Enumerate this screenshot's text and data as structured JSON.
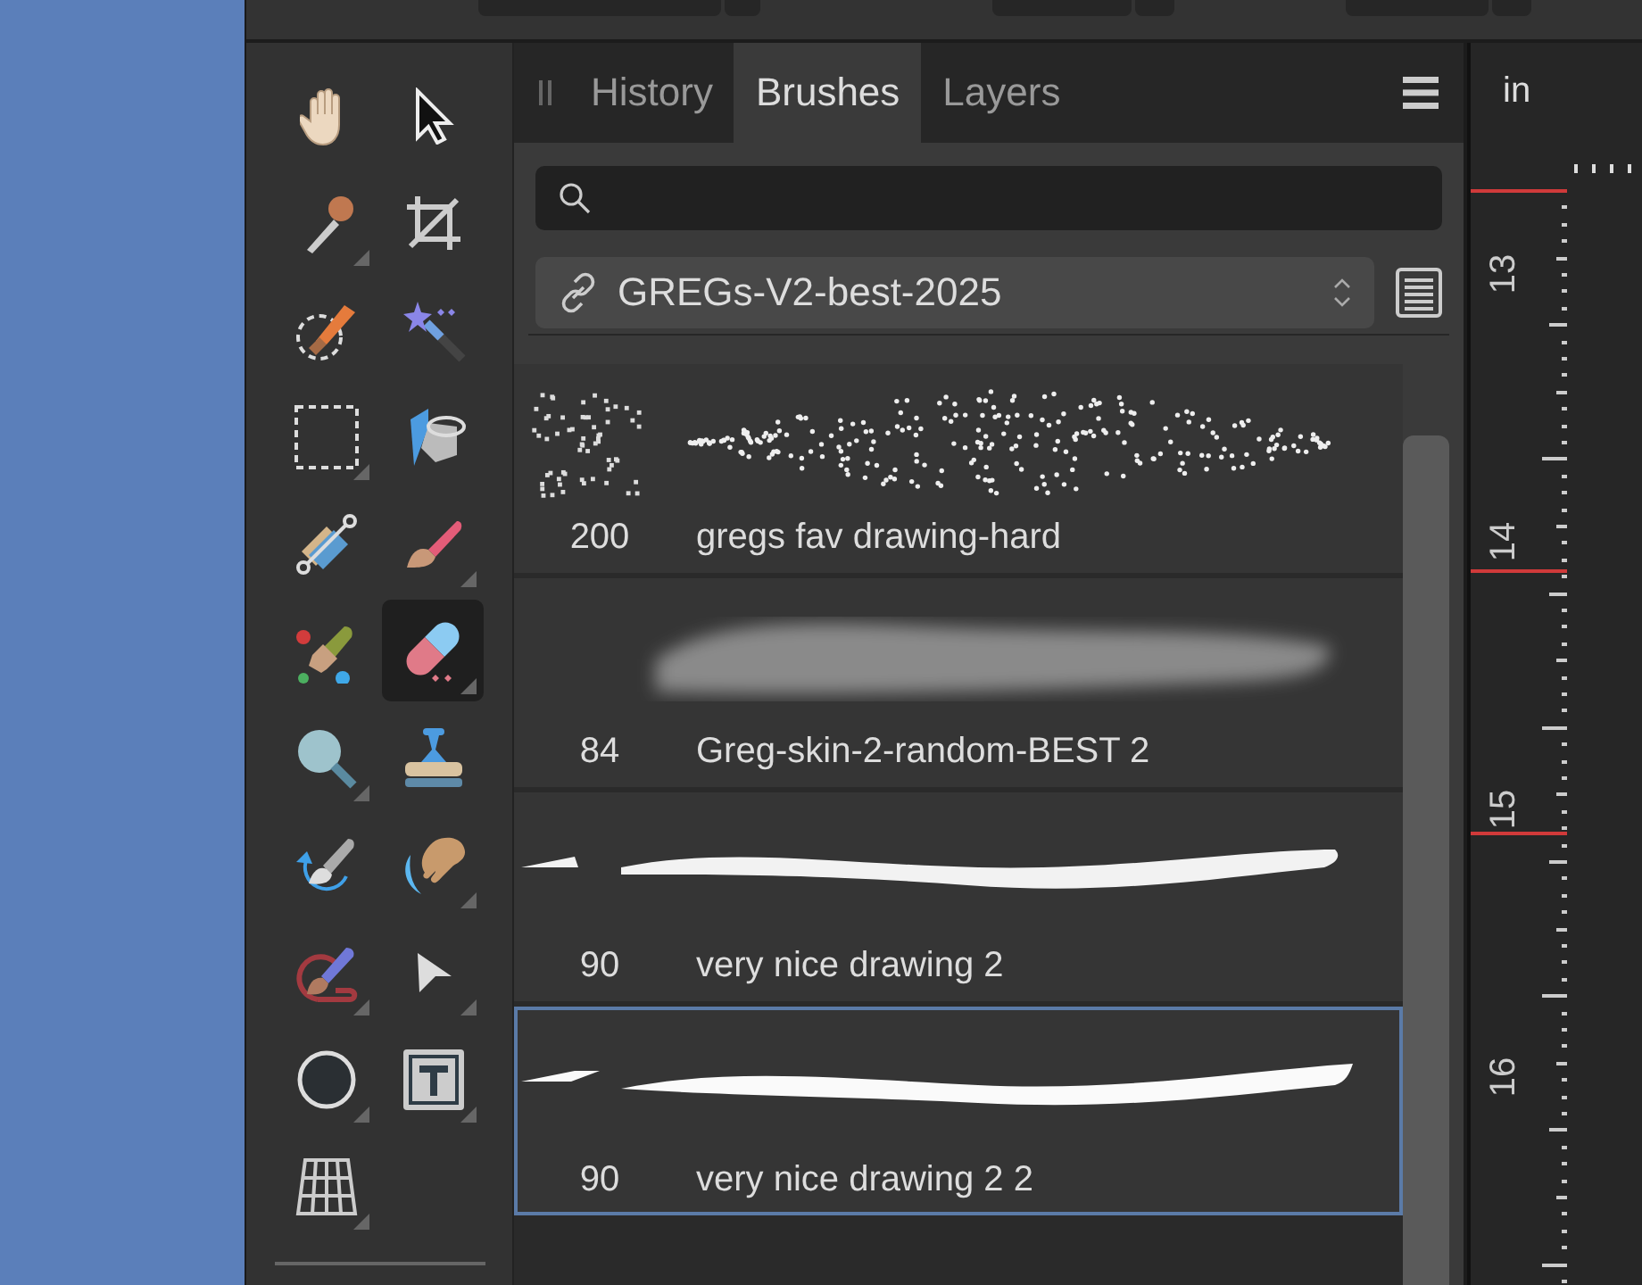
{
  "tools": [
    {
      "selected": false,
      "flyout": false
    },
    {
      "selected": false,
      "flyout": false
    },
    {
      "selected": false,
      "flyout": true
    },
    {
      "selected": false,
      "flyout": false
    },
    {
      "selected": false,
      "flyout": false
    },
    {
      "selected": false,
      "flyout": false
    },
    {
      "selected": false,
      "flyout": true
    },
    {
      "selected": false,
      "flyout": false
    },
    {
      "selected": false,
      "flyout": false
    },
    {
      "selected": false,
      "flyout": true
    },
    {
      "selected": false,
      "flyout": false
    },
    {
      "selected": true,
      "flyout": true
    },
    {
      "selected": false,
      "flyout": true
    },
    {
      "selected": false,
      "flyout": false
    },
    {
      "selected": false,
      "flyout": false
    },
    {
      "selected": false,
      "flyout": true
    },
    {
      "selected": false,
      "flyout": true
    },
    {
      "selected": false,
      "flyout": true
    },
    {
      "selected": false,
      "flyout": true
    },
    {
      "selected": false,
      "flyout": true
    },
    {
      "selected": false,
      "flyout": true
    }
  ],
  "panel": {
    "tabs": [
      {
        "label": "History",
        "selected": false
      },
      {
        "label": "Brushes",
        "selected": true
      },
      {
        "label": "Layers",
        "selected": false
      }
    ],
    "category": "GREGs-V2-best-2025",
    "brushes": [
      {
        "size": "200",
        "name": "gregs fav drawing-hard",
        "kind": "spray",
        "selected": false
      },
      {
        "size": "84",
        "name": "Greg-skin-2-random-BEST 2",
        "kind": "soft",
        "selected": false
      },
      {
        "size": "90",
        "name": "very nice drawing 2",
        "kind": "rough",
        "selected": false
      },
      {
        "size": "90",
        "name": "very nice drawing 2 2",
        "kind": "solid",
        "selected": true
      }
    ]
  },
  "ruler": {
    "unit": "in",
    "labels": [
      "13",
      "14",
      "15",
      "16"
    ]
  }
}
